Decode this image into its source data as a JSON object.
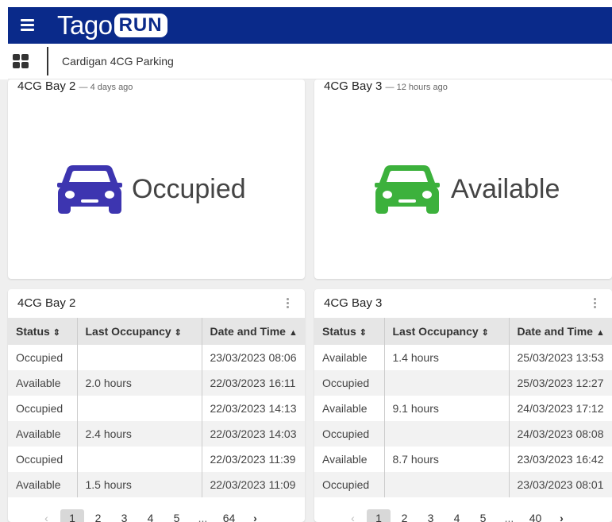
{
  "header": {
    "logo_tago": "Tago",
    "logo_run": "RUN"
  },
  "subheader": {
    "title": "Cardigan 4CG Parking"
  },
  "colors": {
    "brand": "#0a2a8a",
    "occupied": "#3d35b0",
    "available": "#3cb13c"
  },
  "status_cards": [
    {
      "name": "4CG Bay 2",
      "ago": "— 4 days ago",
      "status": "Occupied",
      "icon": "car-icon"
    },
    {
      "name": "4CG Bay 3",
      "ago": "— 12 hours ago",
      "status": "Available",
      "icon": "car-icon"
    }
  ],
  "tables": [
    {
      "title": "4CG Bay 2",
      "columns": [
        "Status",
        "Last Occupancy",
        "Date and Time"
      ],
      "rows": [
        [
          "Occupied",
          "",
          "23/03/2023 08:06"
        ],
        [
          "Available",
          "2.0 hours",
          "22/03/2023 16:11"
        ],
        [
          "Occupied",
          "",
          "22/03/2023 14:13"
        ],
        [
          "Available",
          "2.4 hours",
          "22/03/2023 14:03"
        ],
        [
          "Occupied",
          "",
          "22/03/2023 11:39"
        ],
        [
          "Available",
          "1.5 hours",
          "22/03/2023 11:09"
        ]
      ],
      "pagination": {
        "prev": "‹",
        "pages": [
          "1",
          "2",
          "3",
          "4",
          "5"
        ],
        "ellipsis": "...",
        "last": "64",
        "next": "›",
        "current": "1"
      }
    },
    {
      "title": "4CG Bay 3",
      "columns": [
        "Status",
        "Last Occupancy",
        "Date and Time"
      ],
      "rows": [
        [
          "Available",
          "1.4 hours",
          "25/03/2023 13:53"
        ],
        [
          "Occupied",
          "",
          "25/03/2023 12:27"
        ],
        [
          "Available",
          "9.1 hours",
          "24/03/2023 17:12"
        ],
        [
          "Occupied",
          "",
          "24/03/2023 08:08"
        ],
        [
          "Available",
          "8.7 hours",
          "23/03/2023 16:42"
        ],
        [
          "Occupied",
          "",
          "23/03/2023 08:01"
        ]
      ],
      "pagination": {
        "prev": "‹",
        "pages": [
          "1",
          "2",
          "3",
          "4",
          "5"
        ],
        "ellipsis": "...",
        "last": "40",
        "next": "›",
        "current": "1"
      }
    }
  ]
}
